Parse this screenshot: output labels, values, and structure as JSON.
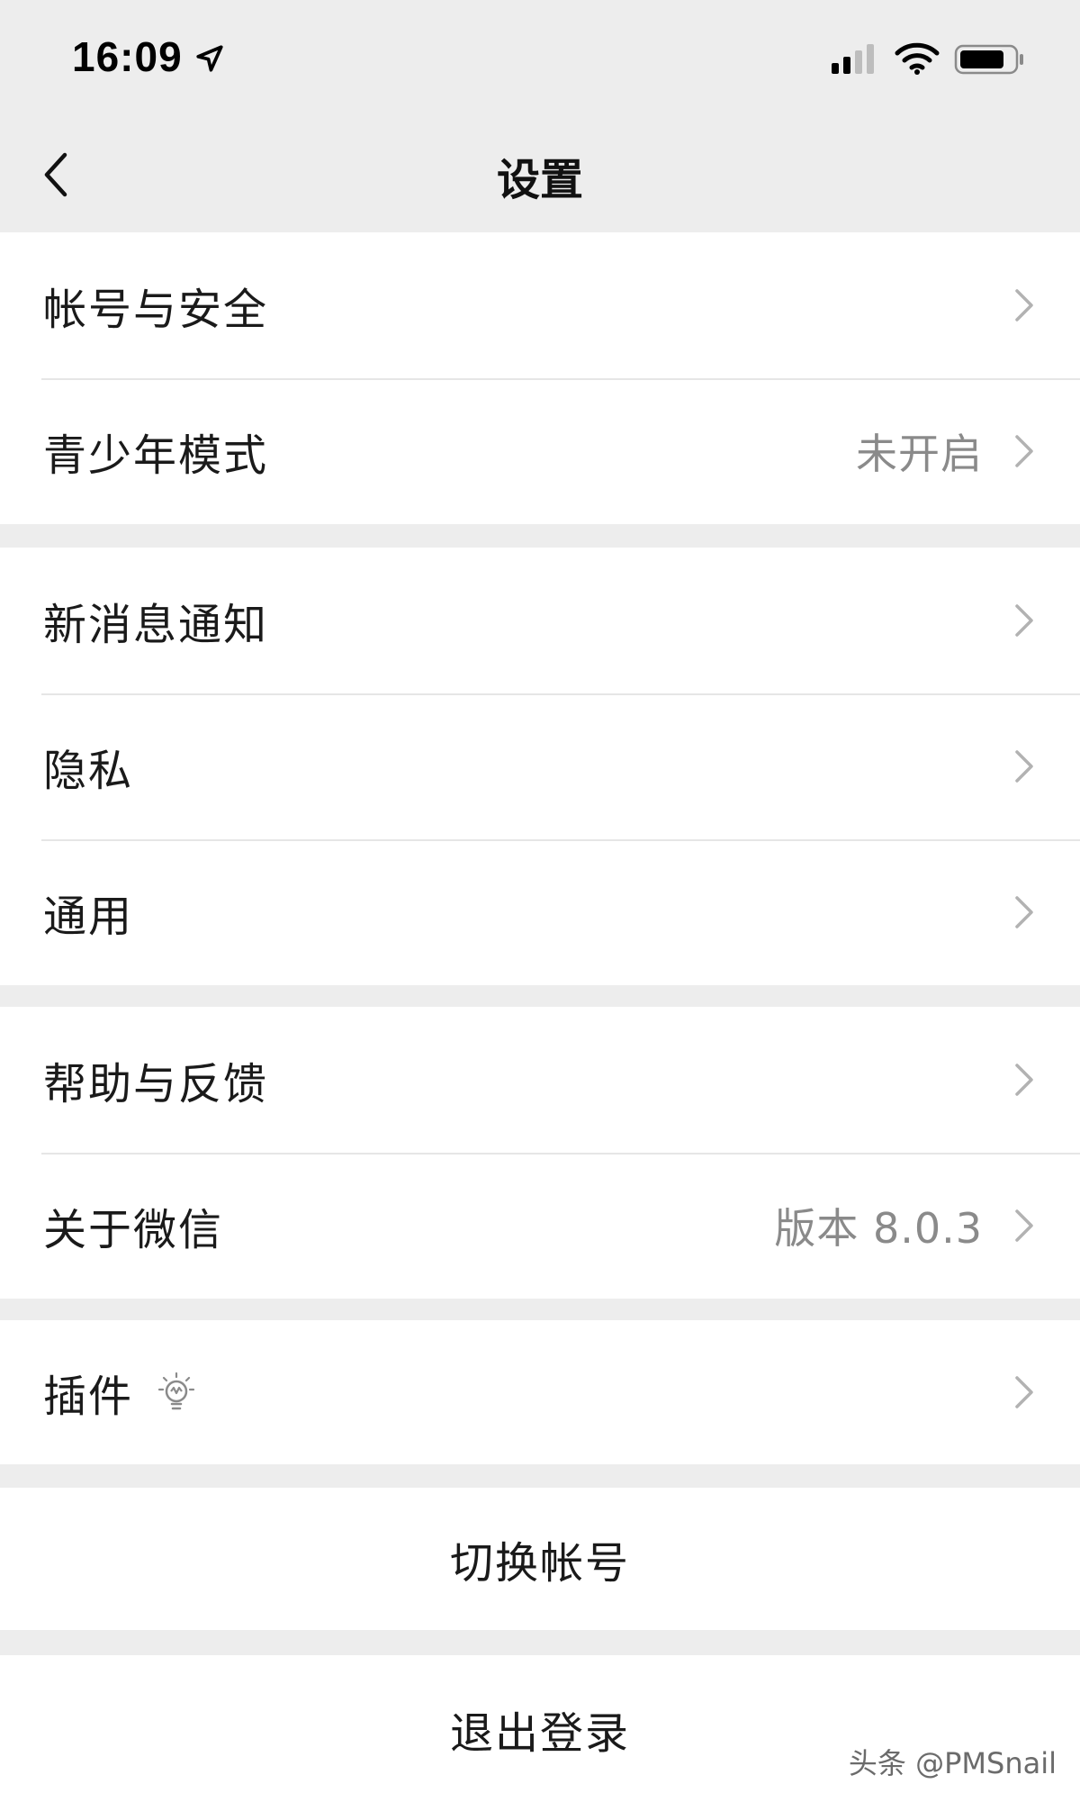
{
  "status_bar": {
    "time": "16:09"
  },
  "nav": {
    "title": "设置"
  },
  "groups": {
    "account": {
      "account_security": "帐号与安全",
      "teen_mode": "青少年模式",
      "teen_mode_value": "未开启"
    },
    "preferences": {
      "notifications": "新消息通知",
      "privacy": "隐私",
      "general": "通用"
    },
    "about": {
      "help_feedback": "帮助与反馈",
      "about_wechat": "关于微信",
      "version": "版本 8.0.3"
    },
    "plugins": {
      "label": "插件"
    },
    "actions": {
      "switch_account": "切换帐号",
      "logout": "退出登录"
    }
  },
  "watermark": "头条 @PMSnail",
  "icons": [
    "back-icon",
    "location-arrow-icon",
    "signal-icon",
    "wifi-icon",
    "battery-icon",
    "chevron-right-icon",
    "lightbulb-icon"
  ]
}
